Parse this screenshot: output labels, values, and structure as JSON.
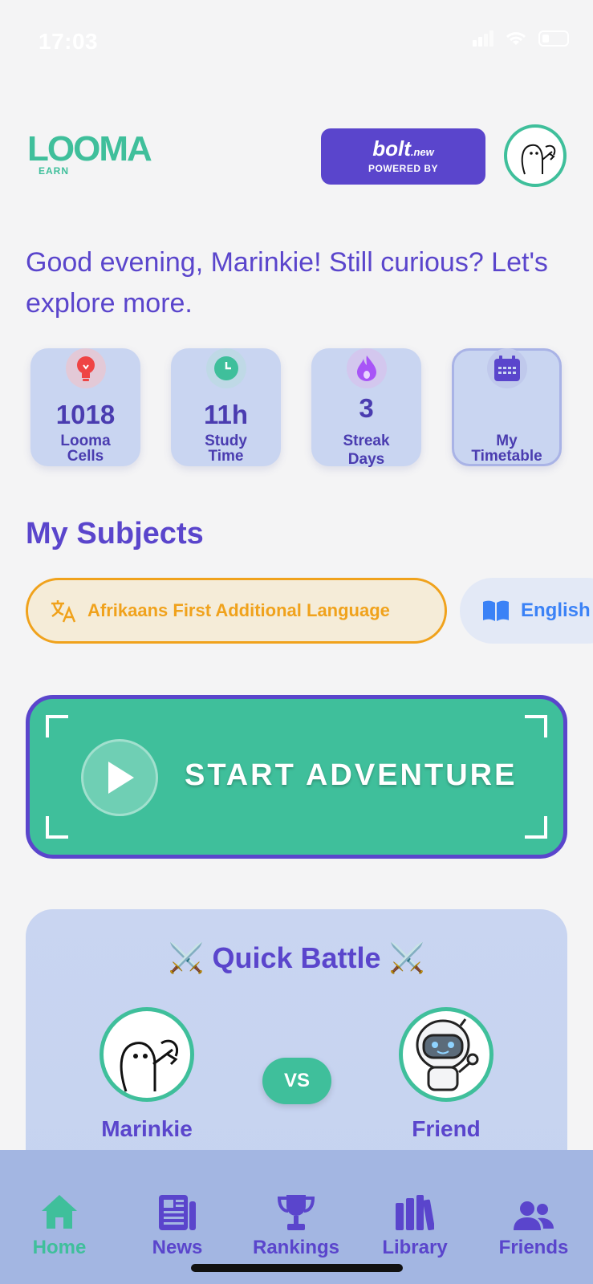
{
  "status_bar": {
    "time": "17:03"
  },
  "header": {
    "logo_main": "LOOMA",
    "logo_sub": "EARN",
    "powered_name": "bolt",
    "powered_suffix": ".new",
    "powered_by": "POWERED BY"
  },
  "greeting": "Good evening, Marinkie! Still curious? Let's explore more.",
  "stats": [
    {
      "value": "1018",
      "label_line1": "Looma",
      "label_line2": "Cells",
      "icon": "lightbulb-icon",
      "color": "#ef4444"
    },
    {
      "value": "11h",
      "label_line1": "Study",
      "label_line2": "Time",
      "icon": "clock-icon",
      "color": "#3fbf9b"
    },
    {
      "value": "3",
      "label_line1": "Streak",
      "label_line2": "Days",
      "icon": "flame-icon",
      "color": "#a855f7"
    },
    {
      "value": "",
      "label_line1": "My",
      "label_line2": "Timetable",
      "icon": "calendar-icon",
      "color": "#5a45cc"
    }
  ],
  "subjects": {
    "title": "My Subjects",
    "items": [
      {
        "label": "Afrikaans First Additional Language",
        "icon": "translate-icon",
        "selected": true,
        "color": "#f0a21c"
      },
      {
        "label": "English",
        "icon": "book-icon",
        "selected": false,
        "color": "#3b82f6"
      }
    ]
  },
  "adventure": {
    "label": "START ADVENTURE"
  },
  "battle": {
    "title": "Quick Battle",
    "player": "Marinkie",
    "vs": "VS",
    "opponent": "Friend"
  },
  "nav": {
    "items": [
      {
        "label": "Home",
        "icon": "home-icon",
        "active": true
      },
      {
        "label": "News",
        "icon": "newspaper-icon",
        "active": false
      },
      {
        "label": "Rankings",
        "icon": "trophy-icon",
        "active": false
      },
      {
        "label": "Library",
        "icon": "library-icon",
        "active": false
      },
      {
        "label": "Friends",
        "icon": "users-icon",
        "active": false
      }
    ]
  },
  "colors": {
    "primary": "#5a45cc",
    "accent": "#3fbf9b",
    "warning": "#f0a21c"
  }
}
